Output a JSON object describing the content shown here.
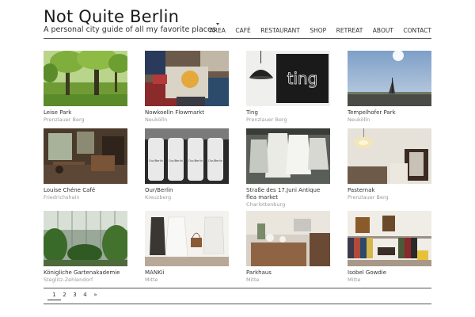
{
  "site": {
    "title": "Not Quite Berlin",
    "tagline": "A personal city guide of all my favorite places"
  },
  "nav": {
    "items": [
      {
        "label": "AREA",
        "active": true
      },
      {
        "label": "CAFÉ"
      },
      {
        "label": "RESTAURANT"
      },
      {
        "label": "SHOP"
      },
      {
        "label": "RETREAT"
      },
      {
        "label": "ABOUT"
      },
      {
        "label": "CONTACT"
      }
    ]
  },
  "places": [
    {
      "title": "Leise Park",
      "area": "Prenzlauer Berg"
    },
    {
      "title": "Nowkoelln Flowmarkt",
      "area": "Neukölln"
    },
    {
      "title": "Ting",
      "area": "Prenzlauer Berg"
    },
    {
      "title": "Tempelhofer Park",
      "area": "Neukölln"
    },
    {
      "title": "Louise Chéne Café",
      "area": "Friedrichshain"
    },
    {
      "title": "Our/Berlin",
      "area": "Kreuzberg"
    },
    {
      "title": "Straße des 17.Juni Antique flea market",
      "area": "Charlottenburg"
    },
    {
      "title": "Pasternak",
      "area": "Prenzlauer Berg"
    },
    {
      "title": "Königliche Gartenakademie",
      "area": "Steglitz-Zehlendorf"
    },
    {
      "title": "MANKii",
      "area": "Mitte"
    },
    {
      "title": "Parkhaus",
      "area": "Mitte"
    },
    {
      "title": "Isobel Gowdie",
      "area": "Mitte"
    }
  ],
  "photo_texts": {
    "ting_sign": "ting",
    "bottle_label": "Our/Berlin"
  },
  "pagination": {
    "pages": [
      "1",
      "2",
      "3",
      "4"
    ],
    "next": "»",
    "current": "1"
  }
}
